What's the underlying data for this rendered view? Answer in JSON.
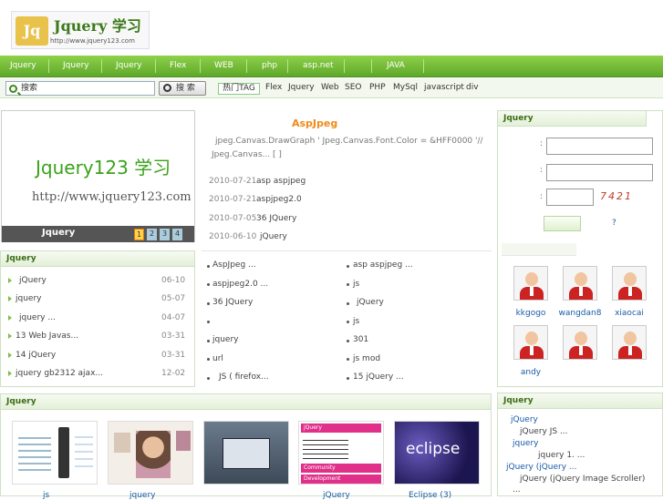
{
  "logo": {
    "mark": "Jq",
    "title": "Jquery 学习",
    "url": "http://www.jquery123.com"
  },
  "nav": [
    "Jquery",
    "Jquery",
    "Jquery",
    "Flex",
    "WEB",
    "php",
    "asp.net",
    "JAVA"
  ],
  "search": {
    "placeholder": "搜索",
    "button": "搜 索",
    "hottag": "热门TAG",
    "tags": [
      "Flex",
      "Jquery",
      "Web",
      "SEO",
      "PHP",
      "MySql",
      "javascript",
      "div"
    ]
  },
  "banner": {
    "line1": "Jquery123 学习",
    "line2": "http://www.jquery123.com",
    "caption": "Jquery",
    "pages": [
      "1",
      "2",
      "3",
      "4"
    ]
  },
  "article": {
    "title": "AspJpeg",
    "excerpt1": "jpeg.Canvas.DrawGraph '      Jpeg.Canvas.Font.Color = &HFF0000 '//",
    "excerpt2": "Jpeg.Canvas...     [   ]",
    "recent": [
      {
        "date": "2010-07-21",
        "text": "asp      aspjpeg"
      },
      {
        "date": "2010-07-21",
        "text": "aspjpeg2.0"
      },
      {
        "date": "2010-07-05",
        "text": "36      JQuery"
      },
      {
        "date": "2010-06-10",
        "text": "jQuery"
      }
    ]
  },
  "jq_list": {
    "title": "Jquery",
    "items": [
      {
        "text": "jQuery",
        "date": "06-10"
      },
      {
        "text": "jquery",
        "date": "05-07"
      },
      {
        "text": "jquery       ...",
        "date": "04-07"
      },
      {
        "text": "13   Web     Javas...",
        "date": "03-31"
      },
      {
        "text": "14   jQuery",
        "date": "03-31"
      },
      {
        "text": "jquery gb2312     ajax...",
        "date": "12-02"
      }
    ]
  },
  "mid_list_a": [
    "AspJpeg          ...",
    "aspjpeg2.0          ...",
    "36      JQuery",
    "",
    "jquery",
    "url",
    "JS  (  firefox..."
  ],
  "mid_list_b": [
    "asp      aspjpeg    ...",
    "js",
    "jQuery",
    "js",
    "301",
    "js mod",
    "15          jQuery ..."
  ],
  "login": {
    "title": "Jquery",
    "captcha": "7421",
    "help": "?",
    "colon": ":"
  },
  "users": [
    {
      "name": "kkgogo"
    },
    {
      "name": "wangdan8"
    },
    {
      "name": "xiaocai"
    },
    {
      "name": "andy"
    },
    {
      "name": ""
    },
    {
      "name": ""
    }
  ],
  "gallery": {
    "title": "Jquery",
    "captions": [
      "js",
      "jquery",
      "",
      "jQuery",
      "Eclipse          (3)"
    ],
    "thumb4": [
      "jQuery",
      "Community",
      "Development"
    ],
    "thumb5": "eclipse"
  },
  "right_bottom": {
    "title": "Jquery",
    "lines": [
      {
        "link": "jQuery",
        "text": ""
      },
      {
        "link": "",
        "text": "jQuery               JS     ..."
      },
      {
        "link": "jquery",
        "text": ""
      },
      {
        "link": "",
        "text": "jquery          1. ..."
      },
      {
        "link": "jQuery      (jQuery ...",
        "text": ""
      },
      {
        "link": "",
        "text": "jQuery         (jQuery Image Scroller)"
      },
      {
        "link": "",
        "text": "..."
      }
    ]
  }
}
